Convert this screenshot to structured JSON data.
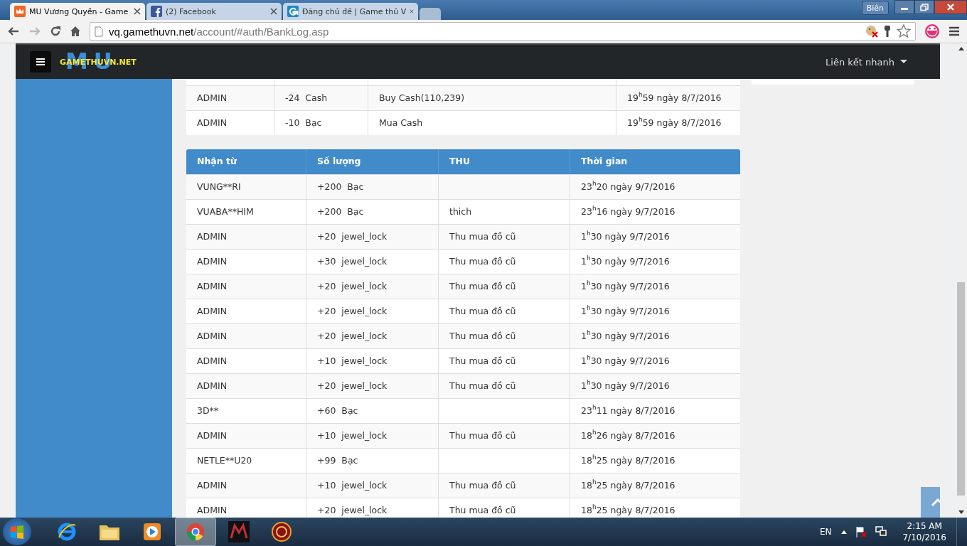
{
  "tabs": [
    {
      "title": "MU Vương Quyền - Game",
      "selected": true
    },
    {
      "title": "(2) Facebook",
      "selected": false
    },
    {
      "title": "Đăng chủ đề | Game thủ V",
      "selected": false
    }
  ],
  "window": {
    "user": "Biên"
  },
  "address": {
    "host": "vq.gamethuvn.net",
    "path": "/account/#auth/BankLog.asp"
  },
  "navbar": {
    "logo": "GAMETHUVN.NET",
    "logo_back": "MU",
    "menu": "Liên kết nhanh"
  },
  "sent_table": {
    "rows": [
      {
        "cells": [
          "ADMIN",
          "-24  Cash",
          "Buy Cash(110,239)",
          "19$^{h}$59 ngày 8/7/2016"
        ]
      },
      {
        "cells": [
          "ADMIN",
          "-10  Bạc",
          "Mua Cash",
          "19$^{h}$59 ngày 8/7/2016"
        ]
      }
    ]
  },
  "received_table": {
    "columns": [
      "Nhận từ",
      "Số lượng",
      "THU",
      "Thời gian"
    ],
    "rows": [
      {
        "cells": [
          "VUNG**RI",
          "+200  Bạc",
          "",
          "23$^{h}$20 ngày 9/7/2016"
        ]
      },
      {
        "cells": [
          "VUABA**HIM",
          "+200  Bạc",
          "thich",
          "23$^{h}$16 ngày 9/7/2016"
        ]
      },
      {
        "cells": [
          "ADMIN",
          "+20  jewel_lock",
          "Thu mua đồ cũ",
          "1$^{h}$30 ngày 9/7/2016"
        ]
      },
      {
        "cells": [
          "ADMIN",
          "+30  jewel_lock",
          "Thu mua đồ cũ",
          "1$^{h}$30 ngày 9/7/2016"
        ]
      },
      {
        "cells": [
          "ADMIN",
          "+20  jewel_lock",
          "Thu mua đồ cũ",
          "1$^{h}$30 ngày 9/7/2016"
        ]
      },
      {
        "cells": [
          "ADMIN",
          "+20  jewel_lock",
          "Thu mua đồ cũ",
          "1$^{h}$30 ngày 9/7/2016"
        ]
      },
      {
        "cells": [
          "ADMIN",
          "+20  jewel_lock",
          "Thu mua đồ cũ",
          "1$^{h}$30 ngày 9/7/2016"
        ]
      },
      {
        "cells": [
          "ADMIN",
          "+10  jewel_lock",
          "Thu mua đồ cũ",
          "1$^{h}$30 ngày 9/7/2016"
        ]
      },
      {
        "cells": [
          "ADMIN",
          "+20  jewel_lock",
          "Thu mua đồ cũ",
          "1$^{h}$30 ngày 9/7/2016"
        ]
      },
      {
        "cells": [
          "3D**",
          "+60  Bạc",
          "",
          "23$^{h}$11 ngày 8/7/2016"
        ]
      },
      {
        "cells": [
          "ADMIN",
          "+10  jewel_lock",
          "Thu mua đồ cũ",
          "18$^{h}$26 ngày 8/7/2016"
        ]
      },
      {
        "cells": [
          "NETLE**U20",
          "+99  Bạc",
          "",
          "18$^{h}$25 ngày 8/7/2016"
        ]
      },
      {
        "cells": [
          "ADMIN",
          "+10  jewel_lock",
          "Thu mua đồ cũ",
          "18$^{h}$25 ngày 8/7/2016"
        ]
      },
      {
        "cells": [
          "ADMIN",
          "+20  jewel_lock",
          "Thu mua đồ cũ",
          "18$^{h}$25 ngày 8/7/2016"
        ]
      }
    ]
  },
  "taskbar": {
    "apps": [
      {
        "kind": "ie",
        "active": false
      },
      {
        "kind": "folder",
        "active": false
      },
      {
        "kind": "media",
        "active": false
      },
      {
        "kind": "chrome",
        "active": true
      },
      {
        "kind": "mu",
        "active": false
      },
      {
        "kind": "game",
        "active": false
      }
    ],
    "language": "EN",
    "time": "2:15 AM",
    "date": "7/10/2016"
  }
}
